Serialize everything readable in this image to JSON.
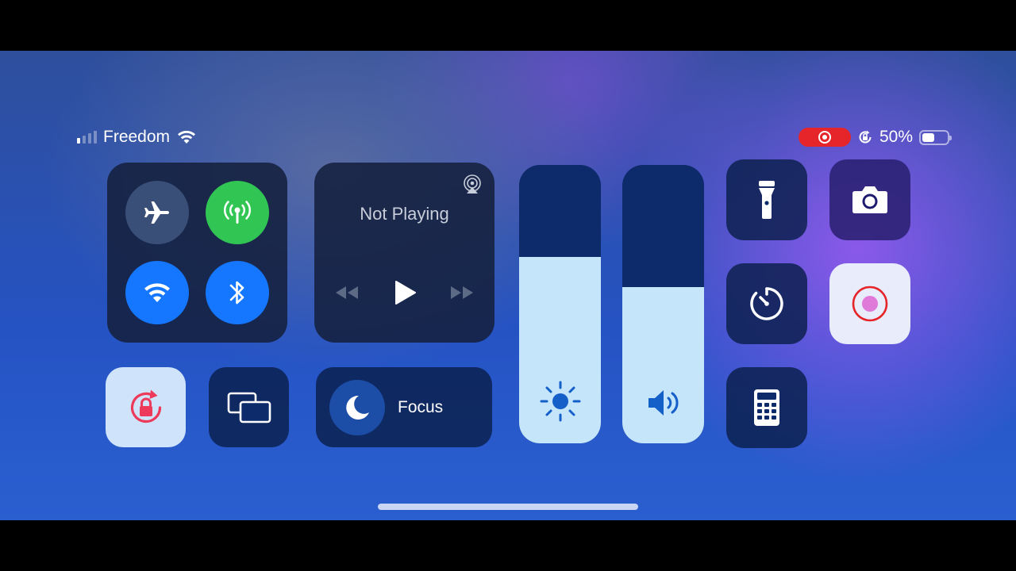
{
  "status_bar": {
    "carrier": "Freedom",
    "signal_bars_active": 1,
    "signal_bars_total": 4,
    "battery_percent_label": "50%",
    "battery_level": 0.5
  },
  "connectivity": {
    "airplane_mode": "off",
    "cellular_data": "on",
    "wifi": "on",
    "bluetooth": "on"
  },
  "now_playing": {
    "title": "Not Playing"
  },
  "sliders": {
    "brightness_level": 0.67,
    "volume_level": 0.56
  },
  "focus": {
    "label": "Focus"
  },
  "colors": {
    "cellular_green": "#31c553",
    "active_blue": "#1577ff",
    "recording_red": "#e5252a",
    "slider_fill": "#c5e5fb",
    "screen_record_dot": "#e07ad8"
  },
  "icons": {
    "airplane": "airplane-icon",
    "cellular": "antenna-icon",
    "wifi": "wifi-icon",
    "bluetooth": "bluetooth-icon",
    "airplay": "airplay-icon",
    "flashlight": "flashlight-icon",
    "camera": "camera-icon",
    "timer": "timer-icon",
    "screen_record": "screen-record-icon",
    "orientation_lock": "orientation-lock-icon",
    "screen_mirroring": "screen-mirroring-icon",
    "calculator": "calculator-icon",
    "brightness": "sun-icon",
    "volume": "speaker-icon",
    "focus": "moon-icon"
  }
}
